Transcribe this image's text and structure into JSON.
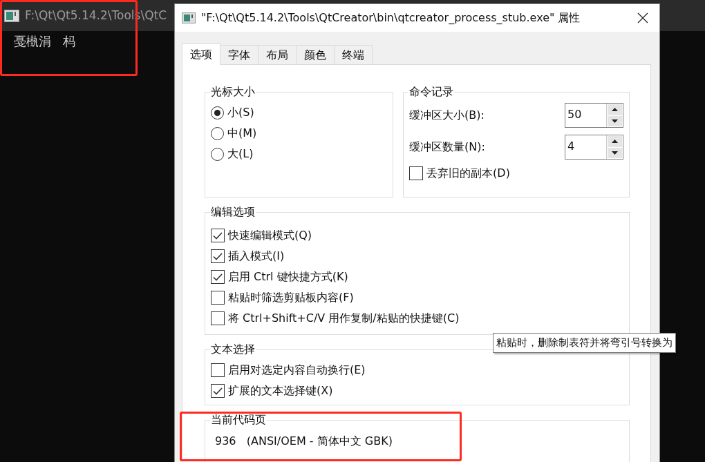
{
  "console": {
    "title": "F:\\Qt\\Qt5.14.2\\Tools\\QtC",
    "output": "戞槸涓   杩"
  },
  "dialog": {
    "title": "\"F:\\Qt\\Qt5.14.2\\Tools\\QtCreator\\bin\\qtcreator_process_stub.exe\" 属性",
    "tabs": [
      {
        "label": "选项",
        "selected": true
      },
      {
        "label": "字体",
        "selected": false
      },
      {
        "label": "布局",
        "selected": false
      },
      {
        "label": "颜色",
        "selected": false
      },
      {
        "label": "终端",
        "selected": false
      }
    ],
    "cursor_size": {
      "title": "光标大小",
      "options": [
        {
          "label": "小(S)",
          "selected": true
        },
        {
          "label": "中(M)",
          "selected": false
        },
        {
          "label": "大(L)",
          "selected": false
        }
      ]
    },
    "command_history": {
      "title": "命令记录",
      "spinners": [
        {
          "label": "缓冲区大小(B):",
          "value": "50"
        },
        {
          "label": "缓冲区数量(N):",
          "value": "4"
        }
      ],
      "discard": {
        "label": "丢弃旧的副本(D)",
        "checked": false
      }
    },
    "edit_options": {
      "title": "编辑选项",
      "items": [
        {
          "label": "快速编辑模式(Q)",
          "checked": true
        },
        {
          "label": "插入模式(I)",
          "checked": true
        },
        {
          "label": "启用 Ctrl 键快捷方式(K)",
          "checked": true
        },
        {
          "label": "粘贴时筛选剪贴板内容(F)",
          "checked": false
        },
        {
          "label": "将 Ctrl+Shift+C/V 用作复制/粘贴的快捷键(C)",
          "checked": false
        }
      ]
    },
    "text_selection": {
      "title": "文本选择",
      "items": [
        {
          "label": "启用对选定内容自动换行(E)",
          "checked": false
        },
        {
          "label": "扩展的文本选择键(X)",
          "checked": true
        }
      ]
    },
    "code_page": {
      "title": "当前代码页",
      "value": "936   (ANSI/OEM - 简体中文 GBK)"
    },
    "tooltip": "粘贴时，删除制表符并将弯引号转换为"
  }
}
